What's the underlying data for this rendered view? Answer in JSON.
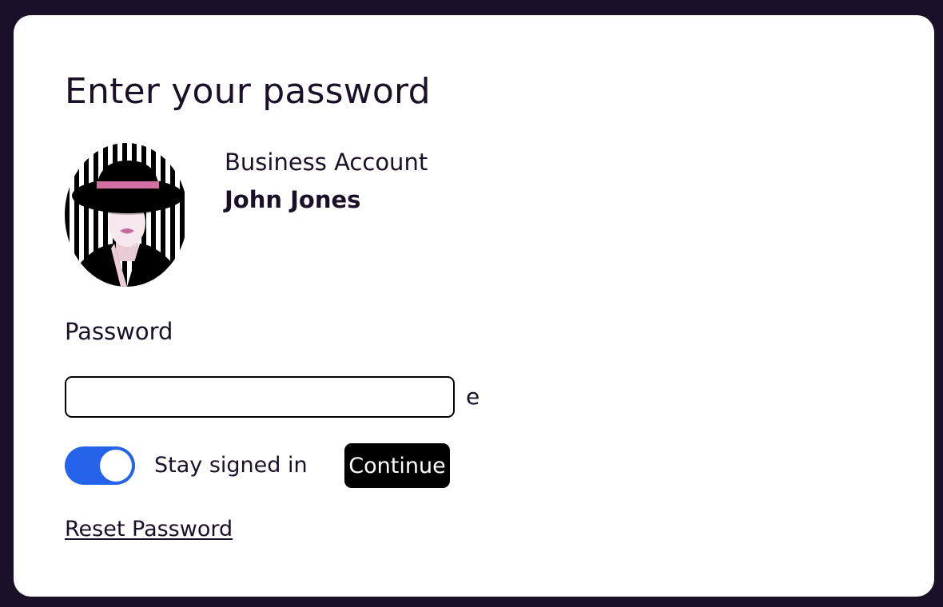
{
  "page": {
    "title": "Enter your password"
  },
  "account": {
    "type_label": "Business Account",
    "user_name": "John Jones",
    "avatar": "striped-portrait-woman-black-hat"
  },
  "password": {
    "label": "Password",
    "value": "",
    "reveal_label": "e"
  },
  "stay_signed_in": {
    "label": "Stay signed in",
    "checked": true
  },
  "actions": {
    "continue_label": "Continue",
    "reset_label": "Reset Password"
  },
  "colors": {
    "background": "#1a1128",
    "card": "#ffffff",
    "text": "#1a1128",
    "toggle_on": "#2563eb",
    "button": "#000000",
    "hat_band": "#d36fa5"
  }
}
